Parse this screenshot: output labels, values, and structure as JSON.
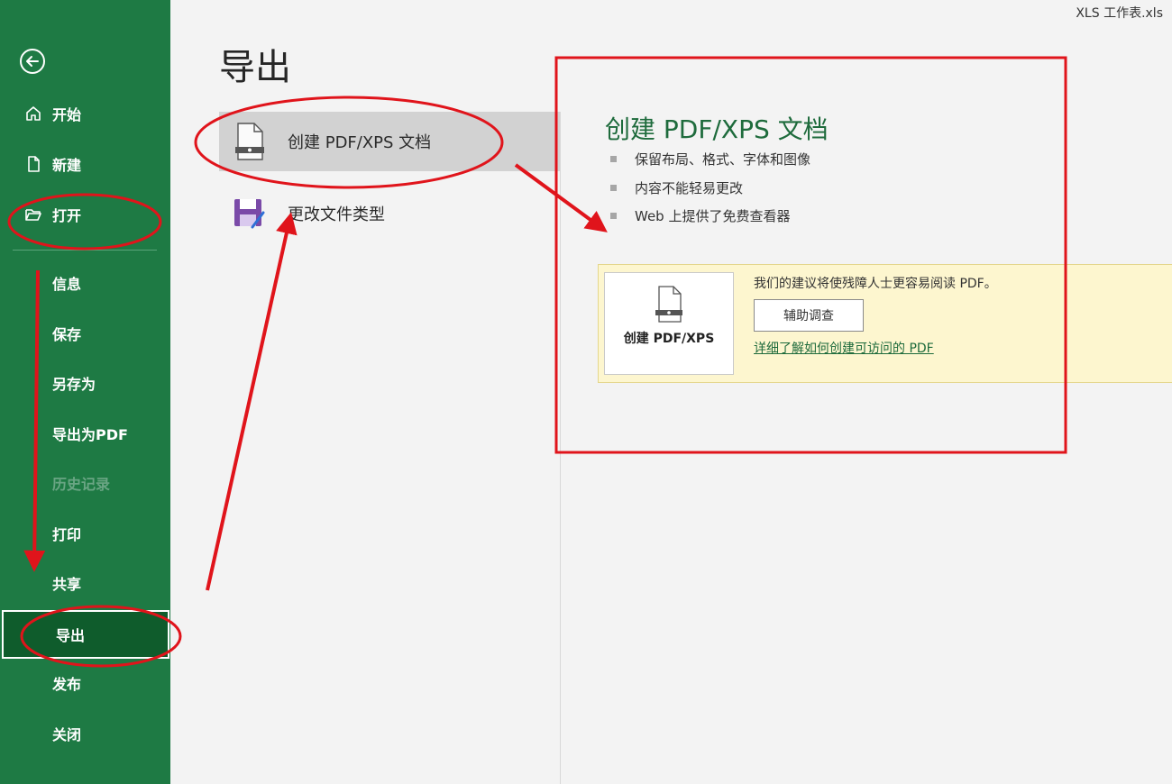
{
  "window": {
    "document_name": "XLS 工作表.xls"
  },
  "sidebar": {
    "back_icon": "back-arrow-icon",
    "items": [
      {
        "label": "开始",
        "icon": "home-icon"
      },
      {
        "label": "新建",
        "icon": "new-document-icon"
      },
      {
        "label": "打开",
        "icon": "open-folder-icon"
      },
      {
        "label": "信息"
      },
      {
        "label": "保存"
      },
      {
        "label": "另存为"
      },
      {
        "label": "导出为PDF"
      },
      {
        "label": "历史记录",
        "disabled": true
      },
      {
        "label": "打印"
      },
      {
        "label": "共享"
      },
      {
        "label": "导出",
        "selected": true
      },
      {
        "label": "发布"
      },
      {
        "label": "关闭"
      }
    ],
    "background_color": "#1e7a44",
    "selected_color": "#0f5c2c"
  },
  "main": {
    "title": "导出",
    "options": [
      {
        "label": "创建 PDF/XPS 文档",
        "icon": "pdf-document-icon",
        "active": true
      },
      {
        "label": "更改文件类型",
        "icon": "save-as-file-type-icon"
      }
    ]
  },
  "detail": {
    "title": "创建 PDF/XPS 文档",
    "bullets": [
      "保留布局、格式、字体和图像",
      "内容不能轻易更改",
      "Web 上提供了免费查看器"
    ],
    "banner": {
      "message": "我们的建议将使残障人士更容易阅读 PDF。",
      "button_label": "辅助调查",
      "link_text": "详细了解如何创建可访问的 PDF",
      "tile_label": "创建 PDF/XPS",
      "tile_icon": "pdf-document-icon"
    }
  },
  "annotation_color": "#e0141b"
}
